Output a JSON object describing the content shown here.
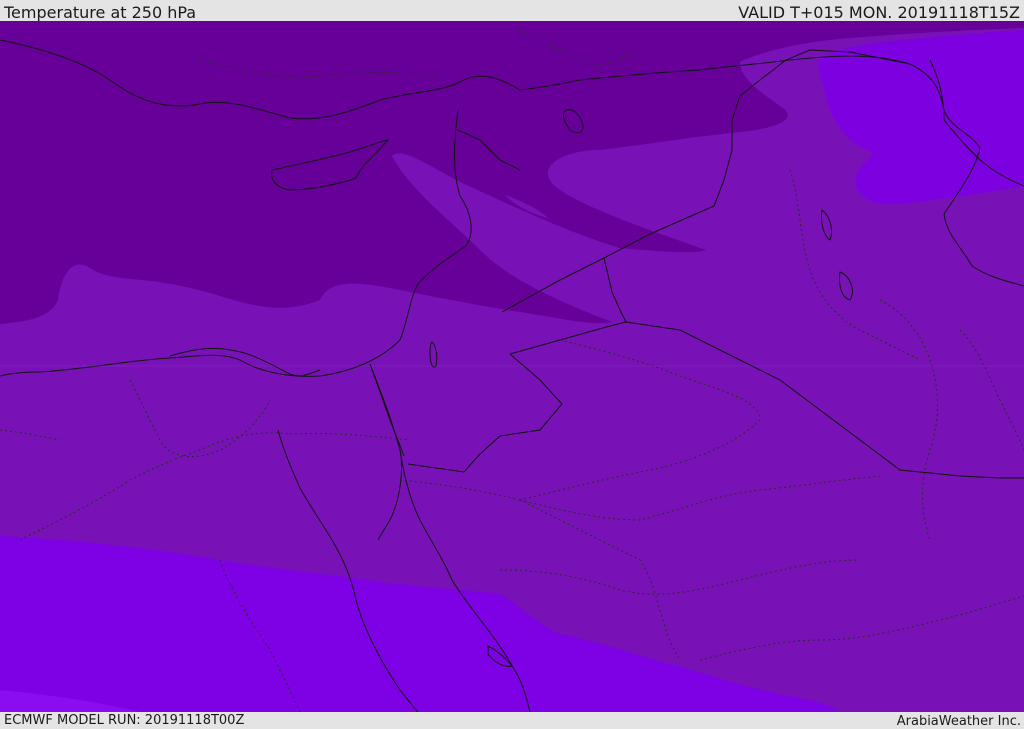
{
  "header": {
    "title": "Temperature at 250 hPa",
    "valid_time": "VALID T+015 MON. 20191118T15Z"
  },
  "footer": {
    "model_run": "ECMWF MODEL RUN: 20191118T00Z",
    "credit": "ArabiaWeather Inc."
  },
  "map": {
    "field": "temperature",
    "level": "250 hPa",
    "palette": {
      "coldest": "#660099",
      "cold_band": "#7a12b3",
      "mid_band": "#7a14b8",
      "warm_band": "#7d00e0",
      "warmest": "#8000e6",
      "coastline": "#141414",
      "admin_border": "#2a2a2a"
    }
  }
}
